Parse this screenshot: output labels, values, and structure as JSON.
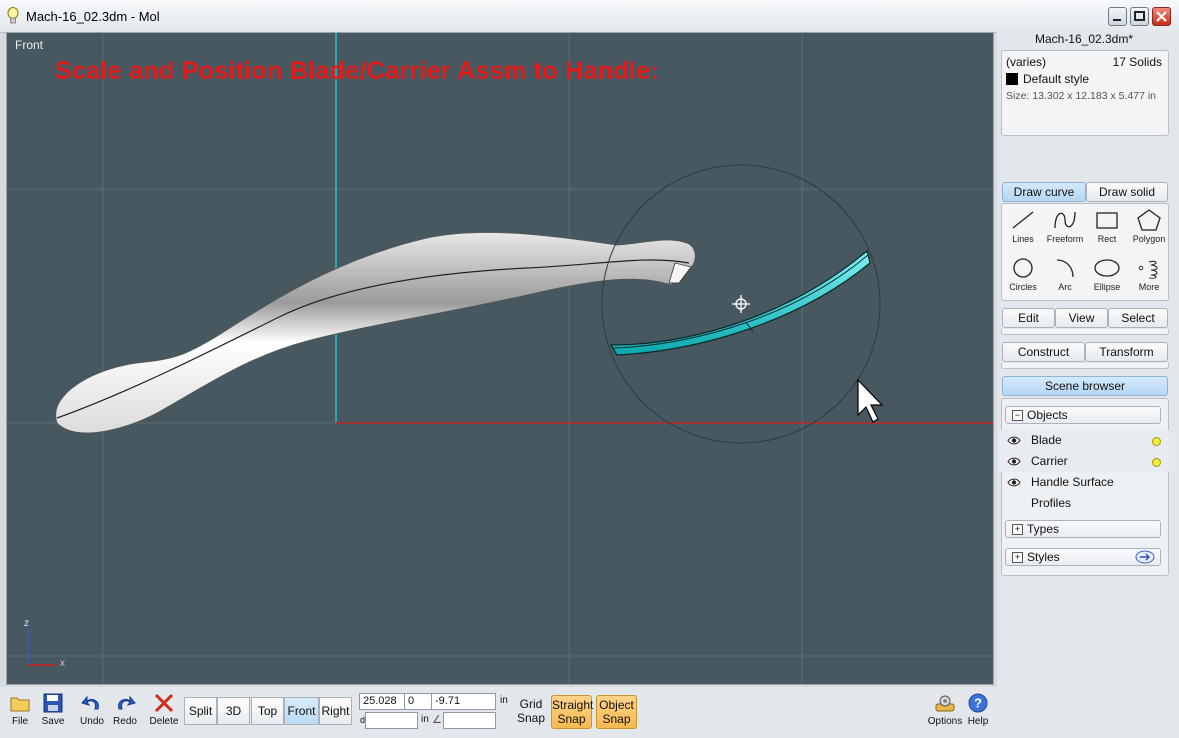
{
  "window": {
    "title": "Mach-16_02.3dm - Mol"
  },
  "viewport": {
    "label": "Front",
    "banner": "Scale and Position Blade/Carrier Assm to Handle:",
    "axis_z": "z",
    "axis_x": "x"
  },
  "panel": {
    "filename": "Mach-16_02.3dm*",
    "info": {
      "selection": "(varies)",
      "count": "17 Solids",
      "style": "Default style",
      "size": "Size: 13.302 x 12.183 x 5.477 in"
    },
    "tabs_draw": [
      "Draw curve",
      "Draw solid"
    ],
    "tools": [
      {
        "label": "Lines",
        "icon": "line-icon"
      },
      {
        "label": "Freeform",
        "icon": "freeform-icon"
      },
      {
        "label": "Rect",
        "icon": "rect-icon"
      },
      {
        "label": "Polygon",
        "icon": "polygon-icon"
      },
      {
        "label": "Circles",
        "icon": "circle-icon"
      },
      {
        "label": "Arc",
        "icon": "arc-icon"
      },
      {
        "label": "Ellipse",
        "icon": "ellipse-icon"
      },
      {
        "label": "More",
        "icon": "more-icon"
      }
    ],
    "tabs_edit": [
      "Edit",
      "View",
      "Select"
    ],
    "tabs_construct": [
      "Construct",
      "Transform"
    ],
    "scene_browser": "Scene browser",
    "objects_header": "Objects",
    "objects": [
      {
        "name": "Blade",
        "visible": true,
        "selected": true
      },
      {
        "name": "Carrier",
        "visible": true,
        "selected": true
      },
      {
        "name": "Handle Surface",
        "visible": true,
        "selected": false
      },
      {
        "name": "Profiles",
        "visible": false,
        "selected": false
      }
    ],
    "types_header": "Types",
    "styles_header": "Styles"
  },
  "toolbar": {
    "file": "File",
    "save": "Save",
    "undo": "Undo",
    "redo": "Redo",
    "delete": "Delete",
    "views": [
      "Split",
      "3D",
      "Top",
      "Front",
      "Right"
    ],
    "active_view": "Front",
    "coord_x": "25.028",
    "coord_y": "0",
    "coord_z": "-9.71",
    "coord_unit": "in",
    "dist_label": "d",
    "dist_unit": "in",
    "angle_symbol": "∠",
    "grid_snap": [
      "Grid",
      "Snap"
    ],
    "straight_snap": [
      "Straight",
      "Snap"
    ],
    "object_snap": [
      "Object",
      "Snap"
    ],
    "options": "Options",
    "help": "Help"
  },
  "colors": {
    "viewport_bg": "#475860",
    "banner": "#e41b1b",
    "accent": "#1fd0d6",
    "snap": "#f5b94d"
  }
}
